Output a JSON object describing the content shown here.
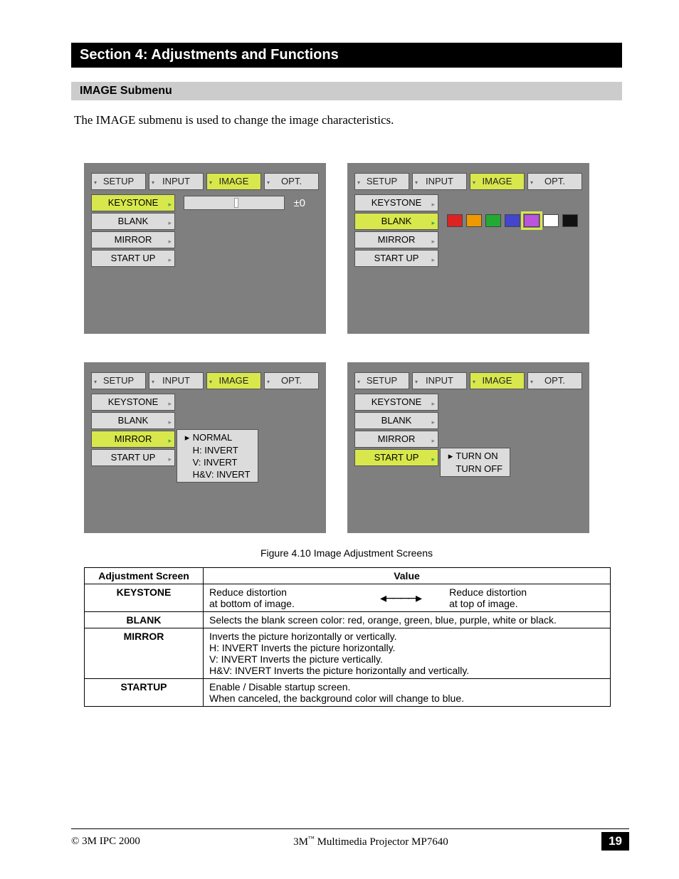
{
  "section_title": "Section 4: Adjustments and Functions",
  "subsection_title": "IMAGE Submenu",
  "intro_text": "The IMAGE submenu is used to change the image characteristics.",
  "tabs": {
    "setup": "SETUP",
    "input": "INPUT",
    "image": "IMAGE",
    "opt": "OPT."
  },
  "menu": {
    "keystone": "KEYSTONE",
    "blank": "BLANK",
    "mirror": "MIRROR",
    "startup": "START UP"
  },
  "keystone_value": "±0",
  "blank_colors": [
    {
      "name": "red",
      "hex": "#d22"
    },
    {
      "name": "orange",
      "hex": "#e90"
    },
    {
      "name": "green",
      "hex": "#2a3"
    },
    {
      "name": "blue",
      "hex": "#44c"
    },
    {
      "name": "purple",
      "hex": "#b5d",
      "selected": true
    },
    {
      "name": "white",
      "hex": "#fff"
    },
    {
      "name": "black",
      "hex": "#111"
    }
  ],
  "mirror_opts": [
    "NORMAL",
    "H: INVERT",
    "V: INVERT",
    "H&V: INVERT"
  ],
  "startup_opts": [
    "TURN ON",
    "TURN OFF"
  ],
  "figure_caption": "Figure 4.10 Image Adjustment Screens",
  "table": {
    "h1": "Adjustment Screen",
    "h2": "Value",
    "keystone": {
      "label": "KEYSTONE",
      "left_top": "Reduce distortion",
      "left_bot": "at bottom of image.",
      "right_top": "Reduce distortion",
      "right_bot": "at top of image."
    },
    "blank": {
      "label": "BLANK",
      "text": "Selects the blank screen color: red, orange, green, blue, purple, white or black."
    },
    "mirror": {
      "label": "MIRROR",
      "l1": "Inverts the picture horizontally or vertically.",
      "l2": "H:  INVERT Inverts the picture horizontally.",
      "l3": "V:  INVERT Inverts the picture vertically.",
      "l4": "H&V:  INVERT Inverts the picture horizontally and vertically."
    },
    "startup": {
      "label": "STARTUP",
      "l1": "Enable / Disable startup screen.",
      "l2": "When canceled, the background color will change to blue."
    }
  },
  "footer": {
    "copyright": "© 3M IPC 2000",
    "product_pre": "3M",
    "product_tm": "™",
    "product_post": " Multimedia Projector MP7640",
    "page": "19"
  }
}
